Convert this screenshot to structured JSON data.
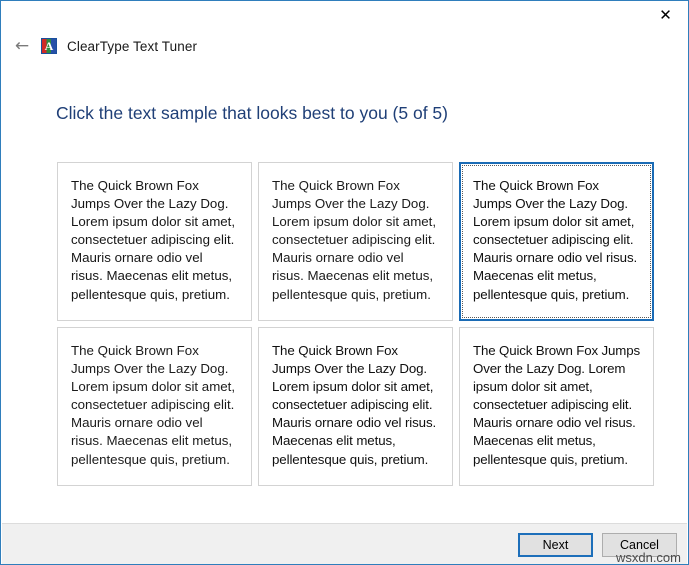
{
  "window": {
    "border_color": "#2f7ebc",
    "close_icon": "✕"
  },
  "titlebar": {
    "close_label": "Close"
  },
  "nav": {
    "back_icon": "←",
    "app_icon_letter": "A",
    "app_title": "ClearType Text Tuner"
  },
  "main": {
    "heading": "Click the text sample that looks best to you (5 of 5)",
    "sample_text": "The Quick Brown Fox Jumps Over the Lazy Dog. Lorem ipsum dolor sit amet, consectetuer adipiscing elit. Mauris ornare odio vel risus. Maecenas elit metus, pellentesque quis, pretium.",
    "samples": [
      {
        "id": "sample-1",
        "selected": false,
        "text": "The Quick Brown Fox Jumps Over the Lazy Dog. Lorem ipsum dolor sit amet, consectetuer adipiscing elit. Mauris ornare odio vel risus. Maecenas elit metus, pellentesque quis, pretium."
      },
      {
        "id": "sample-2",
        "selected": false,
        "text": "The Quick Brown Fox Jumps Over the Lazy Dog. Lorem ipsum dolor sit amet, consectetuer adipiscing elit. Mauris ornare odio vel risus. Maecenas elit metus, pellentesque quis, pretium."
      },
      {
        "id": "sample-3",
        "selected": true,
        "text": "The Quick Brown Fox Jumps Over the Lazy Dog. Lorem ipsum dolor sit amet, consectetuer adipiscing elit. Mauris ornare odio vel risus. Maecenas elit metus, pellentesque quis, pretium."
      },
      {
        "id": "sample-4",
        "selected": false,
        "text": "The Quick Brown Fox Jumps Over the Lazy Dog. Lorem ipsum dolor sit amet, consectetuer adipiscing elit. Mauris ornare odio vel risus. Maecenas elit metus, pellentesque quis, pretium."
      },
      {
        "id": "sample-5",
        "selected": false,
        "text": "The Quick Brown Fox Jumps Over the Lazy Dog. Lorem ipsum dolor sit amet, consectetuer adipiscing elit. Mauris ornare odio vel risus. Maecenas elit metus, pellentesque quis, pretium."
      },
      {
        "id": "sample-6",
        "selected": false,
        "text": "The Quick Brown Fox Jumps Over the Lazy Dog. Lorem ipsum dolor sit amet, consectetuer adipiscing elit. Mauris ornare odio vel risus. Maecenas elit metus, pellentesque quis, pretium."
      }
    ],
    "selected_index": 2,
    "step": "5 of 5"
  },
  "footer": {
    "next_label": "Next",
    "cancel_label": "Cancel"
  },
  "watermark": {
    "text": "wsxdn.com"
  },
  "colors": {
    "window_border": "#2f7ebc",
    "heading_text": "#1f3f77",
    "selection_border": "#1a6bb5",
    "default_button_border": "#1d6fba",
    "box_border": "#d3d3d3",
    "footer_bg": "#f0f0f0"
  }
}
